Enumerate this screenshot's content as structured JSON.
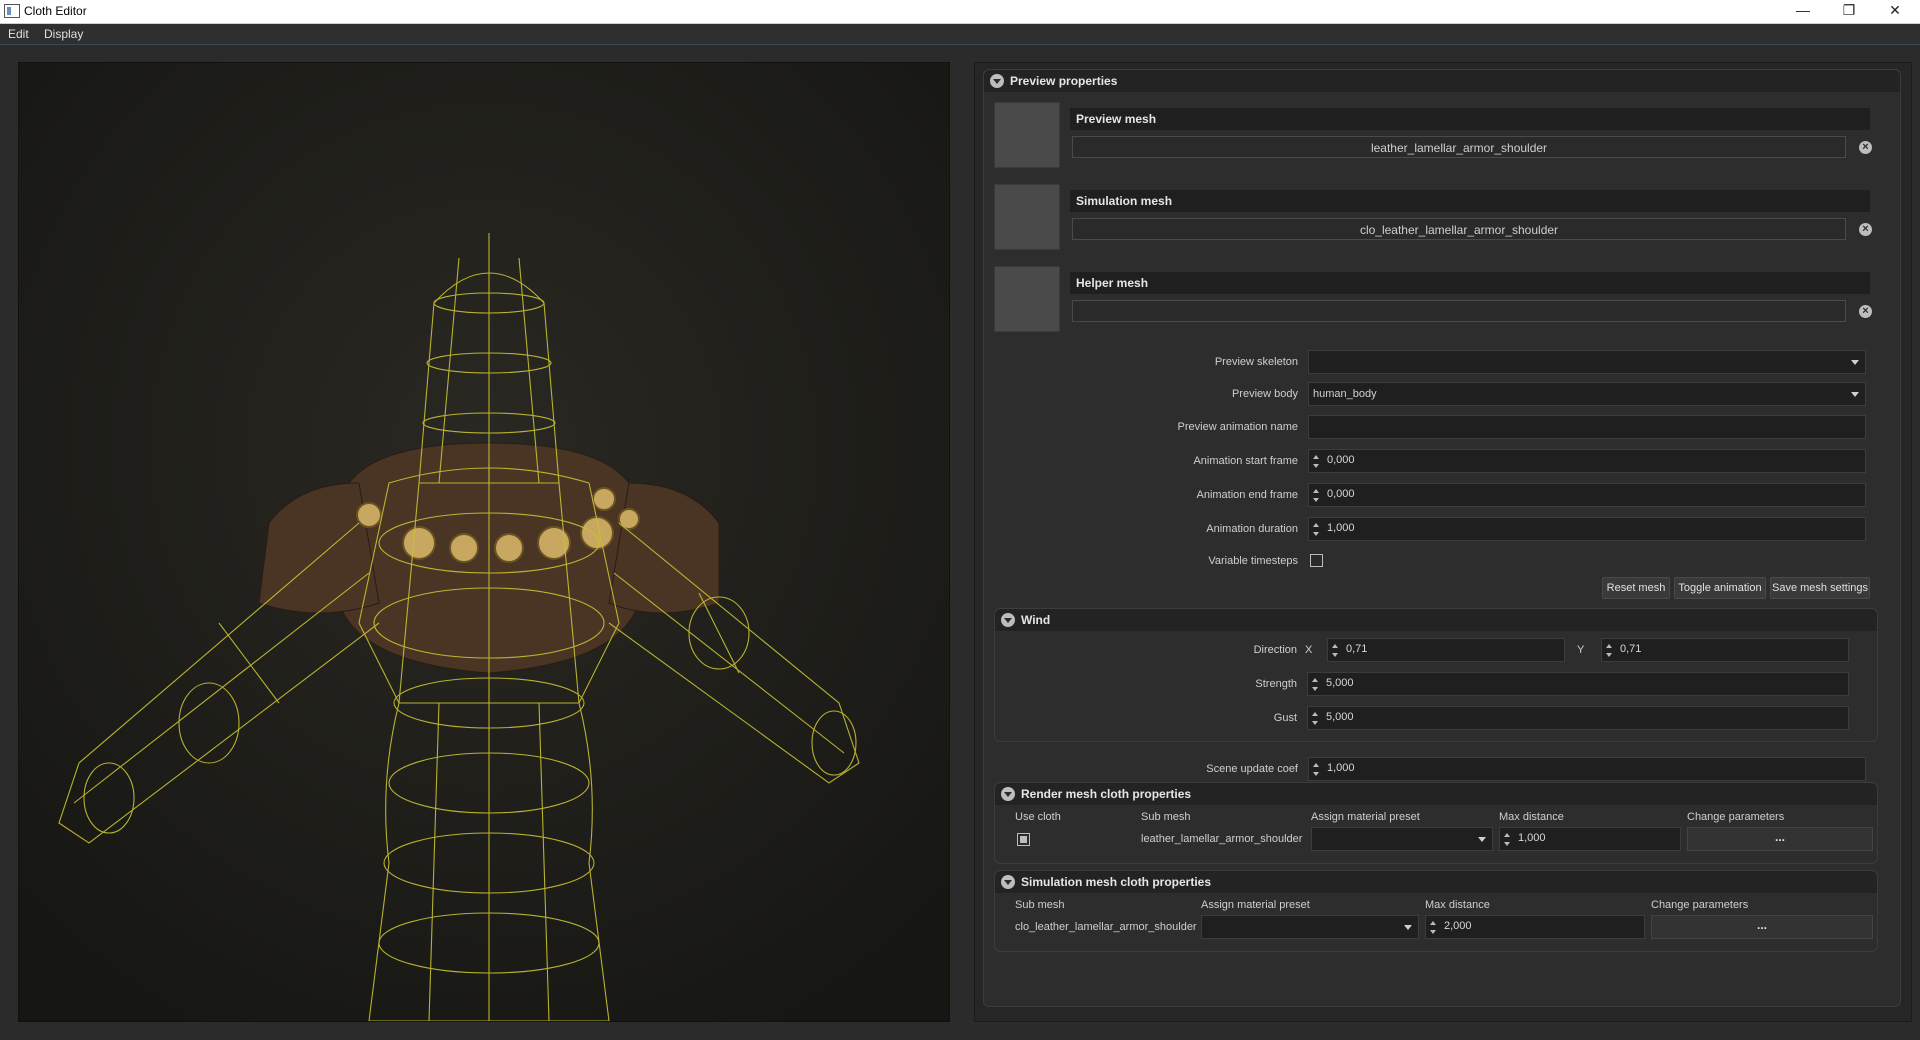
{
  "window": {
    "title": "Cloth Editor"
  },
  "menu": {
    "items": [
      "Edit",
      "Display"
    ]
  },
  "preview": {
    "header": "Preview properties",
    "preview_mesh": {
      "title": "Preview mesh",
      "value": "leather_lamellar_armor_shoulder"
    },
    "simulation_mesh": {
      "title": "Simulation mesh",
      "value": "clo_leather_lamellar_armor_shoulder"
    },
    "helper_mesh": {
      "title": "Helper mesh",
      "value": ""
    },
    "fields": {
      "preview_skeleton": {
        "label": "Preview skeleton",
        "value": ""
      },
      "preview_body": {
        "label": "Preview body",
        "value": "human_body"
      },
      "preview_animation_name": {
        "label": "Preview animation name",
        "value": ""
      },
      "animation_start_frame": {
        "label": "Animation start frame",
        "value": "0,000"
      },
      "animation_end_frame": {
        "label": "Animation end frame",
        "value": "0,000"
      },
      "animation_duration": {
        "label": "Animation duration",
        "value": "1,000"
      },
      "variable_timesteps": {
        "label": "Variable timesteps",
        "checked": false
      }
    },
    "buttons": {
      "reset_mesh": "Reset mesh",
      "toggle_animation": "Toggle animation",
      "save_mesh_settings": "Save mesh settings"
    }
  },
  "wind": {
    "header": "Wind",
    "direction": {
      "label": "Direction",
      "x_label": "X",
      "x": "0,71",
      "y_label": "Y",
      "y": "0,71"
    },
    "strength": {
      "label": "Strength",
      "value": "5,000"
    },
    "gust": {
      "label": "Gust",
      "value": "5,000"
    }
  },
  "scene_update": {
    "label": "Scene update coef",
    "value": "1,000"
  },
  "render_cloth": {
    "header": "Render mesh cloth properties",
    "columns": [
      "Use cloth",
      "Sub mesh",
      "Assign material preset",
      "Max distance",
      "Change parameters"
    ],
    "row": {
      "use_cloth": true,
      "sub_mesh": "leather_lamellar_armor_shoulder",
      "material_preset": "",
      "max_distance": "1,000",
      "change": "..."
    }
  },
  "simulation_cloth": {
    "header": "Simulation mesh cloth properties",
    "columns": [
      "Sub mesh",
      "Assign material preset",
      "Max distance",
      "Change parameters"
    ],
    "row": {
      "sub_mesh": "clo_leather_lamellar_armor_shoulder",
      "material_preset": "",
      "max_distance": "2,000",
      "change": "..."
    }
  },
  "colors": {
    "wireframe": "#c9c233",
    "panel_bg": "#2d2d2d",
    "field_bg": "#1f1f1f"
  },
  "icons": {
    "collapse": "chevron-down-icon",
    "clear": "clear-circle-icon"
  }
}
